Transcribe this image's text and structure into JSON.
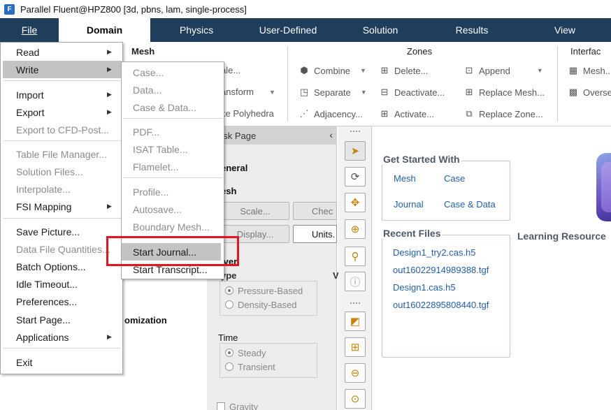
{
  "window": {
    "app_icon": "F",
    "title": "Parallel Fluent@HPZ800  [3d, pbns, lam, single-process]"
  },
  "ribbon": {
    "tabs": [
      {
        "label": "File"
      },
      {
        "label": "Domain"
      },
      {
        "label": "Physics"
      },
      {
        "label": "User-Defined"
      },
      {
        "label": "Solution"
      },
      {
        "label": "Results"
      },
      {
        "label": "View"
      }
    ],
    "mesh_group": {
      "title": "Mesh",
      "items": [
        "ale...",
        "ansform",
        "ke Polyhedra"
      ]
    },
    "zones_group": {
      "title": "Zones",
      "combine": "Combine",
      "separate": "Separate",
      "adjacency": "Adjacency...",
      "delete": "Delete...",
      "deactivate": "Deactivate...",
      "activate": "Activate...",
      "append": "Append",
      "replace_mesh": "Replace Mesh...",
      "replace_zone": "Replace Zone..."
    },
    "interfaces_group": {
      "title": "Interfac",
      "mesh": "Mesh...",
      "overset": "Overse"
    }
  },
  "file_menu": {
    "items": [
      {
        "label": "Read",
        "disabled": false,
        "submenu": true
      },
      {
        "label": "Write",
        "disabled": false,
        "submenu": true,
        "selected": true
      },
      {
        "label": "Import",
        "disabled": false,
        "submenu": true
      },
      {
        "label": "Export",
        "disabled": false,
        "submenu": true
      },
      {
        "label": "Export to CFD-Post...",
        "disabled": true
      },
      {
        "label": "Table File Manager...",
        "disabled": true
      },
      {
        "label": "Solution Files...",
        "disabled": true
      },
      {
        "label": "Interpolate...",
        "disabled": true
      },
      {
        "label": "FSI Mapping",
        "disabled": false,
        "submenu": true
      },
      {
        "label": "Save Picture...",
        "disabled": false
      },
      {
        "label": "Data File Quantities...",
        "disabled": true
      },
      {
        "label": "Batch Options...",
        "disabled": false
      },
      {
        "label": "Idle Timeout...",
        "disabled": false
      },
      {
        "label": "Preferences...",
        "disabled": false
      },
      {
        "label": "Start Page...",
        "disabled": false
      },
      {
        "label": "Applications",
        "disabled": false,
        "submenu": true
      },
      {
        "label": "Exit",
        "disabled": false
      }
    ]
  },
  "write_submenu": {
    "items": [
      {
        "label": "Case...",
        "disabled": true
      },
      {
        "label": "Data...",
        "disabled": true
      },
      {
        "label": "Case & Data...",
        "disabled": true
      },
      {
        "label": "PDF...",
        "disabled": true
      },
      {
        "label": "ISAT Table...",
        "disabled": true
      },
      {
        "label": "Flamelet...",
        "disabled": true
      },
      {
        "label": "Profile...",
        "disabled": true
      },
      {
        "label": "Autosave...",
        "disabled": true
      },
      {
        "label": "Boundary Mesh...",
        "disabled": true
      },
      {
        "label": "Start Journal...",
        "disabled": false,
        "selected": true
      },
      {
        "label": "Start Transcript...",
        "disabled": false
      }
    ]
  },
  "task_page": {
    "header": "ask Page",
    "general": "eneral",
    "mesh": "esh",
    "scale_btn": "Scale...",
    "check_btn": "Chec",
    "display_btn": "Display...",
    "units_btn": "Units.",
    "solver": "lver",
    "type": "ype",
    "pressure_based": "Pressure-Based",
    "density_based": "Density-Based",
    "time": "Time",
    "steady": "Steady",
    "transient": "Transient",
    "gravity": "Gravity",
    "v_label": "V",
    "optimization": "omization"
  },
  "start_page": {
    "get_started_title": "Get Started With",
    "links": [
      "Mesh",
      "Case",
      "Journal",
      "Case & Data"
    ],
    "recent_title": "Recent Files",
    "recent_files": [
      "Design1_try2.cas.h5",
      "out16022914989388.tgf",
      "Design1.cas.h5",
      "out16022895808440.tgf"
    ],
    "learning_title": "Learning Resource"
  },
  "colors": {
    "ribbon_tab_bg": "#1e3e5c",
    "highlight_border": "#e8141c",
    "link": "#1f5fb8"
  }
}
